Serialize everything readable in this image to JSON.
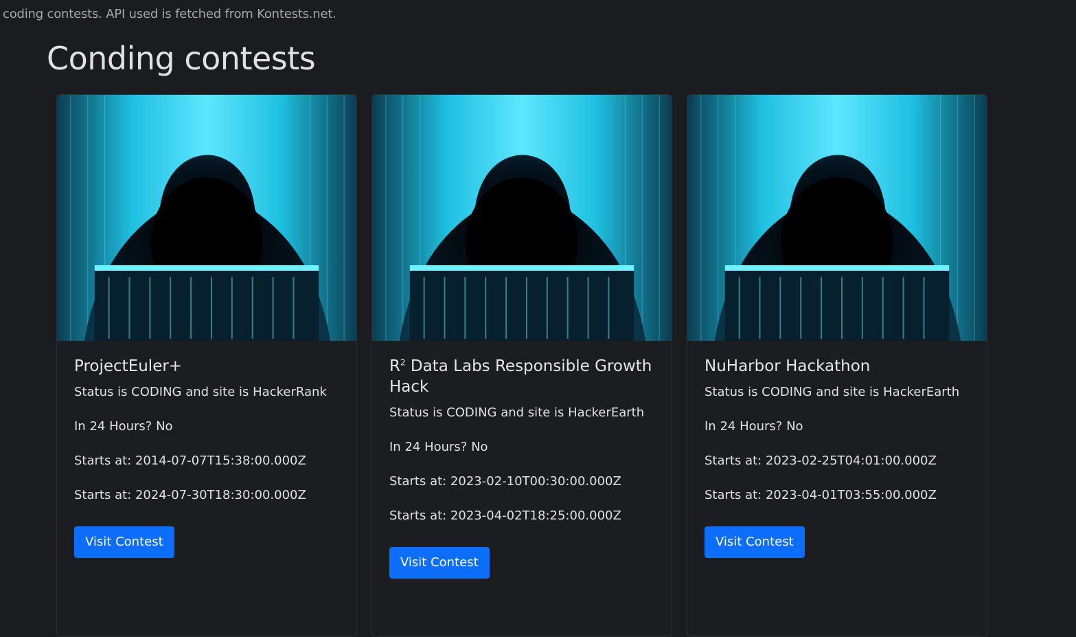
{
  "intro_note": "coding contests. API used is fetched from Kontests.net.",
  "page_title": "Conding contests",
  "colors": {
    "background": "#1a1c1f",
    "button": "#0d6efd",
    "image_accent": "#27d3f2"
  },
  "cards": [
    {
      "image_icon": "hooded-hacker-image",
      "title_main": "ProjectEuler+",
      "title_sup": "",
      "title_rest": "",
      "status_text": "Status is CODING and site is HackerRank",
      "in24_text": "In 24 Hours? No",
      "start_text": "Starts at: 2014-07-07T15:38:00.000Z",
      "end_text": "Starts at: 2024-07-30T18:30:00.000Z",
      "button_label": "Visit Contest"
    },
    {
      "image_icon": "hooded-hacker-image",
      "title_main": "R",
      "title_sup": "2",
      "title_rest": " Data Labs Responsible Growth Hack",
      "status_text": "Status is CODING and site is HackerEarth",
      "in24_text": "In 24 Hours? No",
      "start_text": "Starts at: 2023-02-10T00:30:00.000Z",
      "end_text": "Starts at: 2023-04-02T18:25:00.000Z",
      "button_label": "Visit Contest"
    },
    {
      "image_icon": "hooded-hacker-image",
      "title_main": "NuHarbor Hackathon",
      "title_sup": "",
      "title_rest": "",
      "status_text": "Status is CODING and site is HackerEarth",
      "in24_text": "In 24 Hours? No",
      "start_text": "Starts at: 2023-02-25T04:01:00.000Z",
      "end_text": "Starts at: 2023-04-01T03:55:00.000Z",
      "button_label": "Visit Contest"
    }
  ]
}
